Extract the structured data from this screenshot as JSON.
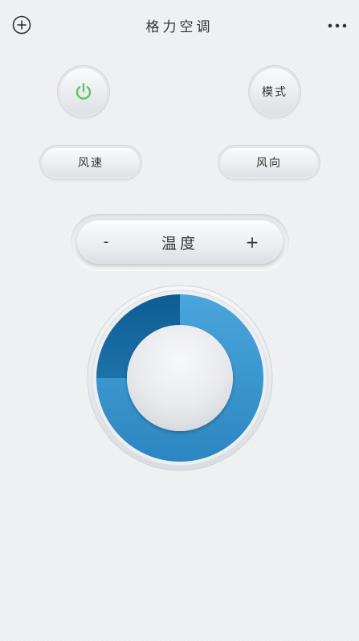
{
  "header": {
    "title": "格力空调",
    "add_icon": "plus-circle-icon",
    "more_icon": "more-horizontal-icon"
  },
  "controls": {
    "power_icon": "power-icon",
    "power_color": "#5cc562",
    "mode_label": "模式",
    "wind_speed_label": "风速",
    "wind_direction_label": "风向"
  },
  "temperature": {
    "label": "温度",
    "minus_label": "-",
    "plus_label": "+"
  },
  "dial": {
    "accent_light": "#3f9fd6",
    "accent_dark": "#0d5f96",
    "level": 0.75
  }
}
